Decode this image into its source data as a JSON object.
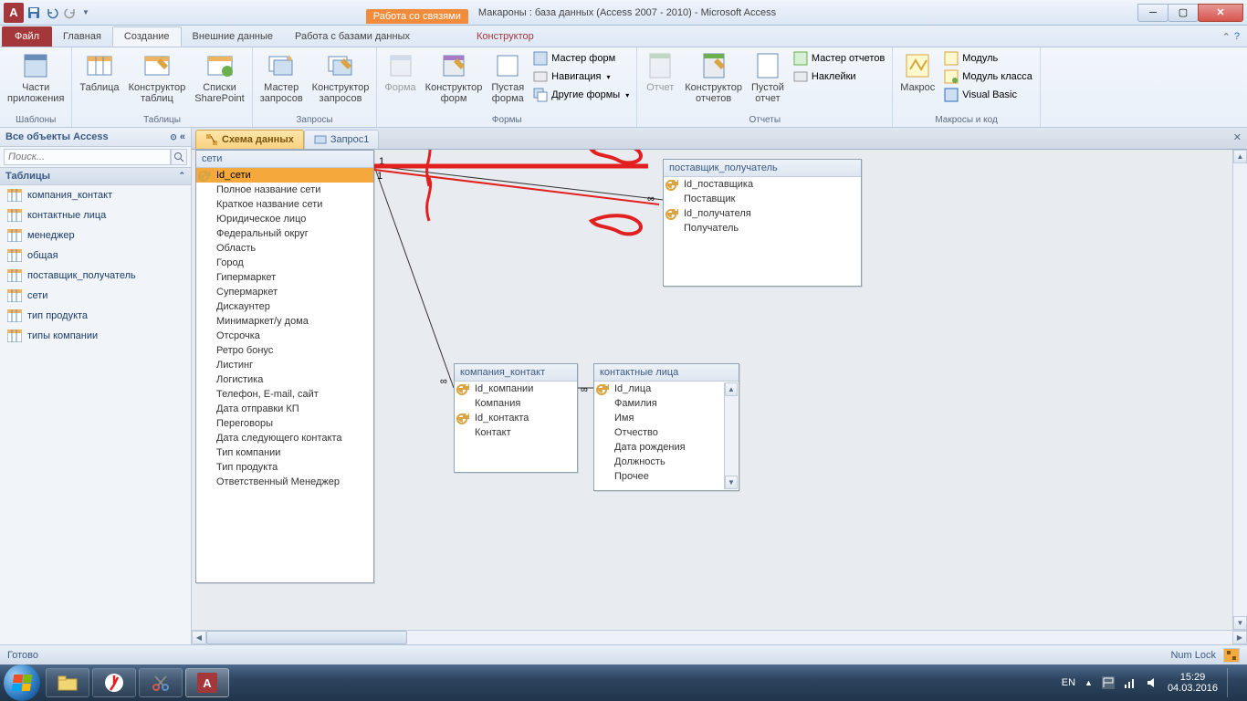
{
  "title": {
    "context": "Работа со связями",
    "text": "Макароны : база данных (Access 2007 - 2010)  -  Microsoft Access"
  },
  "tabs": {
    "file": "Файл",
    "home": "Главная",
    "create": "Создание",
    "external": "Внешние данные",
    "dbtools": "Работа с базами данных",
    "ctx": "Конструктор"
  },
  "ribbon": {
    "g1": {
      "label": "Шаблоны",
      "b1": "Части\nприложения"
    },
    "g2": {
      "label": "Таблицы",
      "b1": "Таблица",
      "b2": "Конструктор\nтаблиц",
      "b3": "Списки\nSharePoint"
    },
    "g3": {
      "label": "Запросы",
      "b1": "Мастер\nзапросов",
      "b2": "Конструктор\nзапросов"
    },
    "g4": {
      "label": "Формы",
      "b1": "Форма",
      "b2": "Конструктор\nформ",
      "b3": "Пустая\nформа",
      "s1": "Мастер форм",
      "s2": "Навигация",
      "s3": "Другие формы"
    },
    "g5": {
      "label": "Отчеты",
      "b1": "Отчет",
      "b2": "Конструктор\nотчетов",
      "b3": "Пустой\nотчет",
      "s1": "Мастер отчетов",
      "s2": "Наклейки"
    },
    "g6": {
      "label": "Макросы и код",
      "b1": "Макрос",
      "s1": "Модуль",
      "s2": "Модуль класса",
      "s3": "Visual Basic"
    }
  },
  "nav": {
    "head": "Все объекты Access",
    "search_placeholder": "Поиск...",
    "group": "Таблицы",
    "items": [
      "компания_контакт",
      "контактные лица",
      "менеджер",
      "общая",
      "поставщик_получатель",
      "сети",
      "тип продукта",
      "типы компании"
    ]
  },
  "doctabs": {
    "t1": "Схема данных",
    "t2": "Запрос1"
  },
  "tables": {
    "seti": {
      "title": "сети",
      "fields": [
        {
          "n": "Id_сети",
          "k": true,
          "sel": true
        },
        {
          "n": "Полное название сети"
        },
        {
          "n": "Краткое название сети"
        },
        {
          "n": "Юридическое лицо"
        },
        {
          "n": "Федеральный округ"
        },
        {
          "n": "Область"
        },
        {
          "n": "Город"
        },
        {
          "n": "Гипермаркет"
        },
        {
          "n": "Супермаркет"
        },
        {
          "n": "Дискаунтер"
        },
        {
          "n": "Минимаркет/у дома"
        },
        {
          "n": "Отсрочка"
        },
        {
          "n": "Ретро бонус"
        },
        {
          "n": "Листинг"
        },
        {
          "n": "Логистика"
        },
        {
          "n": "Телефон, E-mail, сайт"
        },
        {
          "n": "Дата отправки КП"
        },
        {
          "n": "Переговоры"
        },
        {
          "n": "Дата следующего контакта"
        },
        {
          "n": "Тип компании"
        },
        {
          "n": "Тип продукта"
        },
        {
          "n": "Ответственный Менеджер"
        }
      ]
    },
    "post": {
      "title": "поставщик_получатель",
      "fields": [
        {
          "n": "Id_поставщика",
          "k": true
        },
        {
          "n": "Поставщик"
        },
        {
          "n": "Id_получателя",
          "k": true
        },
        {
          "n": "Получатель"
        }
      ]
    },
    "komp": {
      "title": "компания_контакт",
      "fields": [
        {
          "n": "Id_компании",
          "k": true
        },
        {
          "n": "Компания"
        },
        {
          "n": "Id_контакта",
          "k": true
        },
        {
          "n": "Контакт"
        }
      ]
    },
    "kont": {
      "title": "контактные лица",
      "fields": [
        {
          "n": "Id_лица",
          "k": true
        },
        {
          "n": "Фамилия"
        },
        {
          "n": "Имя"
        },
        {
          "n": "Отчество"
        },
        {
          "n": "Дата рождения"
        },
        {
          "n": "Должность"
        },
        {
          "n": "Прочее"
        }
      ]
    }
  },
  "rel": {
    "one": "1",
    "inf": "∞"
  },
  "status": {
    "ready": "Готово",
    "numlock": "Num Lock"
  },
  "tray": {
    "lang": "EN",
    "time": "15:29",
    "date": "04.03.2016"
  }
}
